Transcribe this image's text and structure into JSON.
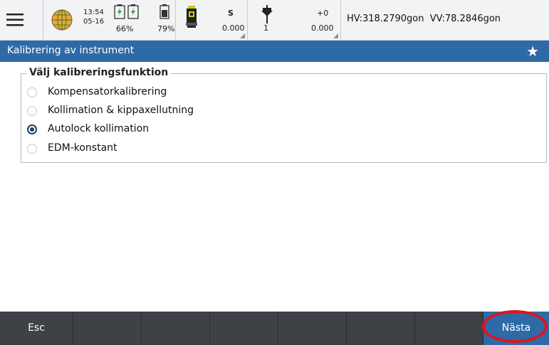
{
  "statusbar": {
    "time": "13:54",
    "date": "05-16",
    "battery_left": "66%",
    "battery_right": "79%",
    "s_label": "S",
    "s_value": "0.000",
    "target_count": "1",
    "height_label": "+0",
    "height_value": "0.000",
    "angles": "HV:318.2790gon  VV:78.2846gon"
  },
  "titlebar": {
    "title": "Kalibrering av instrument"
  },
  "group": {
    "legend": "Välj kalibreringsfunktion",
    "options": [
      {
        "label": "Kompensatorkalibrering",
        "selected": false
      },
      {
        "label": "Kollimation & kippaxellutning",
        "selected": false
      },
      {
        "label": "Autolock kollimation",
        "selected": true
      },
      {
        "label": "EDM-konstant",
        "selected": false
      }
    ]
  },
  "bottombar": {
    "esc_label": "Esc",
    "next_label": "Nästa"
  },
  "colors": {
    "accent": "#2e6aa6",
    "bottombar": "#3e4145",
    "highlight": "#e0141c"
  }
}
